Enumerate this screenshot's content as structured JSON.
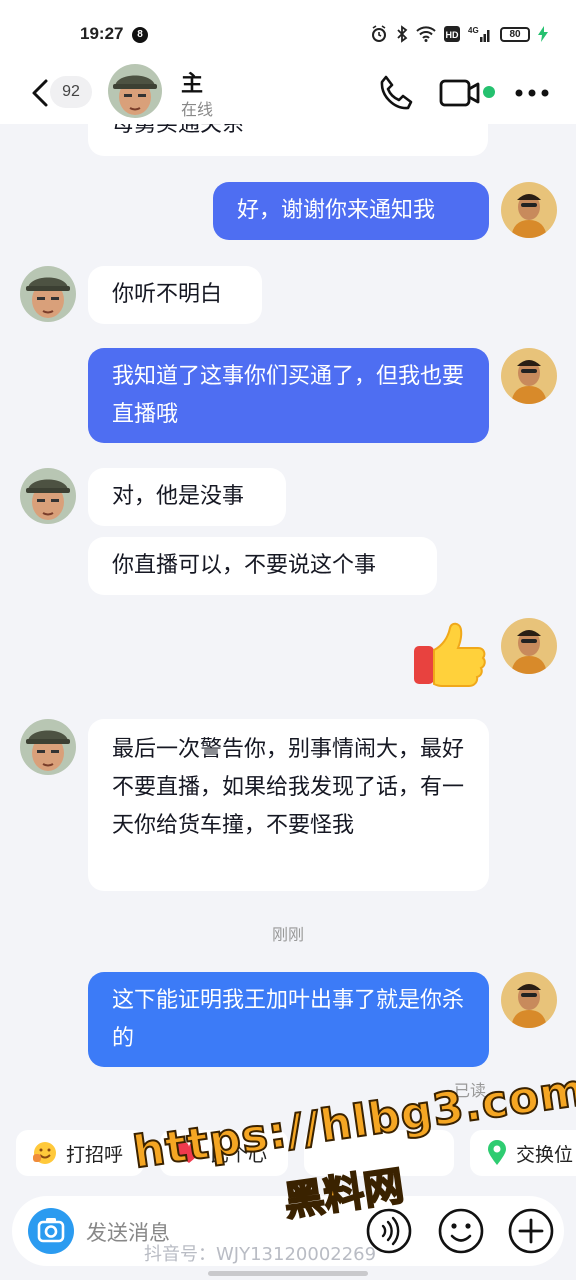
{
  "status_bar": {
    "time": "19:27",
    "notification_count": "8",
    "battery": "80"
  },
  "header": {
    "unread_count": "92",
    "contact_name": "主",
    "presence": "在线"
  },
  "messages": [
    {
      "side": "in",
      "text": "母舅买通关系"
    },
    {
      "side": "out",
      "text": "好，谢谢你来通知我"
    },
    {
      "side": "in",
      "text": "你听不明白"
    },
    {
      "side": "out",
      "text": "我知道了这事你们买通了，但我也要直播哦"
    },
    {
      "side": "in",
      "text": "对，他是没事"
    },
    {
      "side": "in",
      "text": "你直播可以，不要说这个事"
    },
    {
      "side": "out",
      "type": "emoji",
      "emoji": "thumbs-up"
    },
    {
      "side": "in",
      "text": "最后一次警告你，别事情闹大，最好不要直播，如果给我发现了话，有一天你给货车撞，不要怪我"
    },
    {
      "side": "out",
      "text": "这下能证明我王加叶出事了就是你杀的"
    }
  ],
  "timestamp": "刚刚",
  "read_receipt": "已读",
  "quick_replies": [
    {
      "label": "打招呼",
      "icon": "wave-emoji"
    },
    {
      "label": "比个心",
      "icon": "heart-emoji"
    },
    {
      "label": "",
      "icon": "blank"
    },
    {
      "label": "交换位",
      "icon": "location-icon"
    }
  ],
  "input": {
    "placeholder": "发送消息"
  },
  "watermark": {
    "url": "https://hlbg3.com",
    "site": "黑料网",
    "douyin": "抖音号：WJY13120002269"
  },
  "colors": {
    "outgoing_bubble": "#4e6ef2",
    "incoming_bubble": "#ffffff",
    "online": "#25c16f",
    "camera_button": "#2b9bf0"
  }
}
